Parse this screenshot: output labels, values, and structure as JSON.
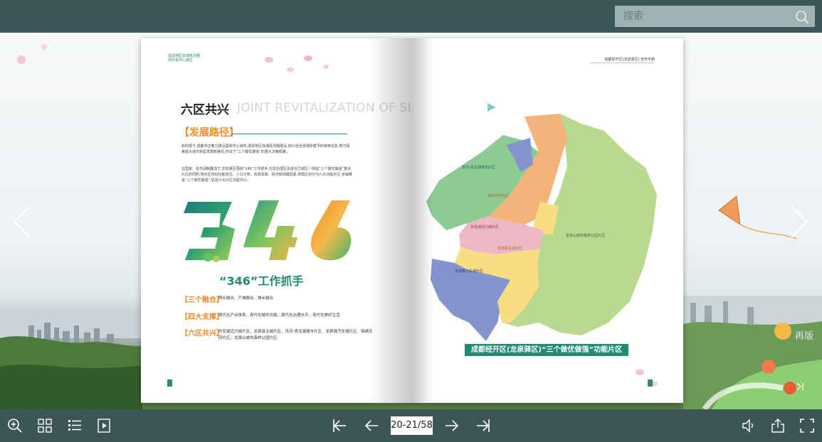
{
  "search": {
    "placeholder": "搜索"
  },
  "left_page": {
    "header_small": "成渝地区双城经济圈\n现代化中心城区",
    "section_title": "六区共兴",
    "section_title_en": "JOINT REVITALIZATION OF SIX DISTRICTS",
    "path_title": "【发展路径】",
    "para1": "新时期下,成都市正着力建设国家中心城市,成渝地区双城经济圈建设,四川省全省域所赋予的使命任务,努力探索超大城市转型发展新路径,作出了“三个做优做强”的重大决策部署。",
    "para2": "在国家、省市战略叠加下,龙泉驿区围绕“346”工作抓手,在双治理区东进活力城区一体提“三个做优做强”重点片区的同时,将全区规划功能定位、人口分布、资源禀赋、经济和规模因素,将辖区划分为六大功能片区,全域推进“三个做优做强”,促进六大片区共建共兴。",
    "work_title": "“346”工作抓手",
    "rows": [
      {
        "label": "【三个融合】",
        "text": "两业融合、产城融合、城乡融合"
      },
      {
        "label": "【四大支撑】",
        "text": "现代化产业体系、现代化城市功能、现代化治理水平、现代化美好生活"
      },
      {
        "label": "【六区共兴】",
        "text": "东安湖活力城片区、龙泉驿主城片区、洪河-青龙湖城市片区、龙泉驿汽车城片区、锦绣天府片区、龙泉山城市森林公园片区"
      }
    ]
  },
  "right_page": {
    "header_small": "成都经开区(龙泉驿区)·宣传手册",
    "map_caption": "成都经开区(龙泉驿区)“三个做优做强”功能片区",
    "map_labels": [
      "洪河-青龙湖城市片区",
      "锦绣天府片区",
      "东安湖活力城片区",
      "龙泉驿主城片区",
      "龙泉驿汽车城片区",
      "龙泉山城市森林公园片区"
    ]
  },
  "side": {
    "reprint_label": "再版"
  },
  "toolbar": {
    "page_counter": "20-21/58"
  },
  "colors": {
    "bar": "#3d5558",
    "accent_green": "#1f8a76",
    "accent_orange": "#f08c2c"
  },
  "icons": {
    "top": [
      "search-icon"
    ],
    "bottom_left": [
      "zoom-in-icon",
      "thumbnails-icon",
      "table-of-contents-icon",
      "autoplay-icon"
    ],
    "bottom_center": [
      "first-page-icon",
      "previous-page-icon",
      "next-page-icon",
      "last-page-icon"
    ],
    "bottom_right": [
      "sound-icon",
      "share-icon",
      "fullscreen-icon"
    ]
  }
}
